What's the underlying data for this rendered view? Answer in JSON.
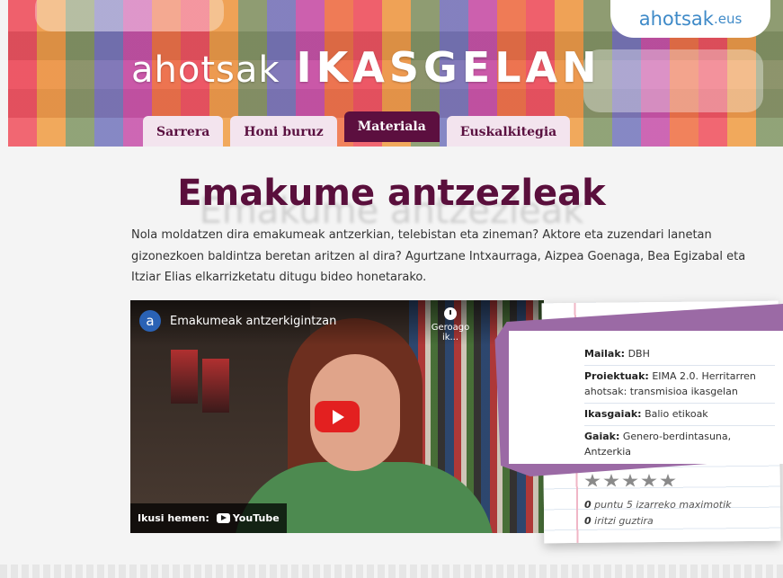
{
  "header": {
    "logo_part1": "ahotsak",
    "logo_part2": "IKASGELAN",
    "site_name": "ahotsak",
    "site_suffix": ".eus",
    "nav": [
      {
        "label": "Sarrera",
        "active": false
      },
      {
        "label": "Honi buruz",
        "active": false
      },
      {
        "label": "Materiala",
        "active": true
      },
      {
        "label": "Euskalkitegia",
        "active": false
      }
    ]
  },
  "main": {
    "title": "Emakume antzezleak",
    "intro": "Nola moldatzen dira emakumeak antzerkian, telebistan eta zineman? Aktore eta zuzendari lanetan gizonezkoen baldintza beretan aritzen al dira? Agurtzane Intxaurraga, Aizpea Goenaga, Bea Egizabal eta Itziar Elias elkarrizketatu ditugu bideo honetarako."
  },
  "video": {
    "channel_initial": "a",
    "title": "Emakumeak antzerkigintzan",
    "watch_later": "Geroago ik...",
    "watch_on": "Ikusi hemen:",
    "youtube": "YouTube"
  },
  "info": {
    "mailak_label": "Mailak:",
    "mailak_value": "DBH",
    "proiektuak_label": "Proiektuak:",
    "proiektuak_value": "EIMA 2.0. Herritarren ahotsak: transmisioa ikasgelan",
    "ikasgaiak_label": "Ikasgaiak:",
    "ikasgaiak_value": "Balio etikoak",
    "gaiak_label": "Gaiak:",
    "gaiak_value": "Genero-berdintasuna, Antzerkia",
    "rating_value": "0",
    "rating_text": "puntu 5 izarreko maximotik",
    "reviews_value": "0",
    "reviews_text": "iritzi guztira"
  },
  "colors": {
    "accent": "#5c0f3f",
    "tab_bg": "#f3e4ee",
    "stripe": "#9b6aa5",
    "youtube_red": "#e32020",
    "site_blue": "#3f8ac8"
  }
}
